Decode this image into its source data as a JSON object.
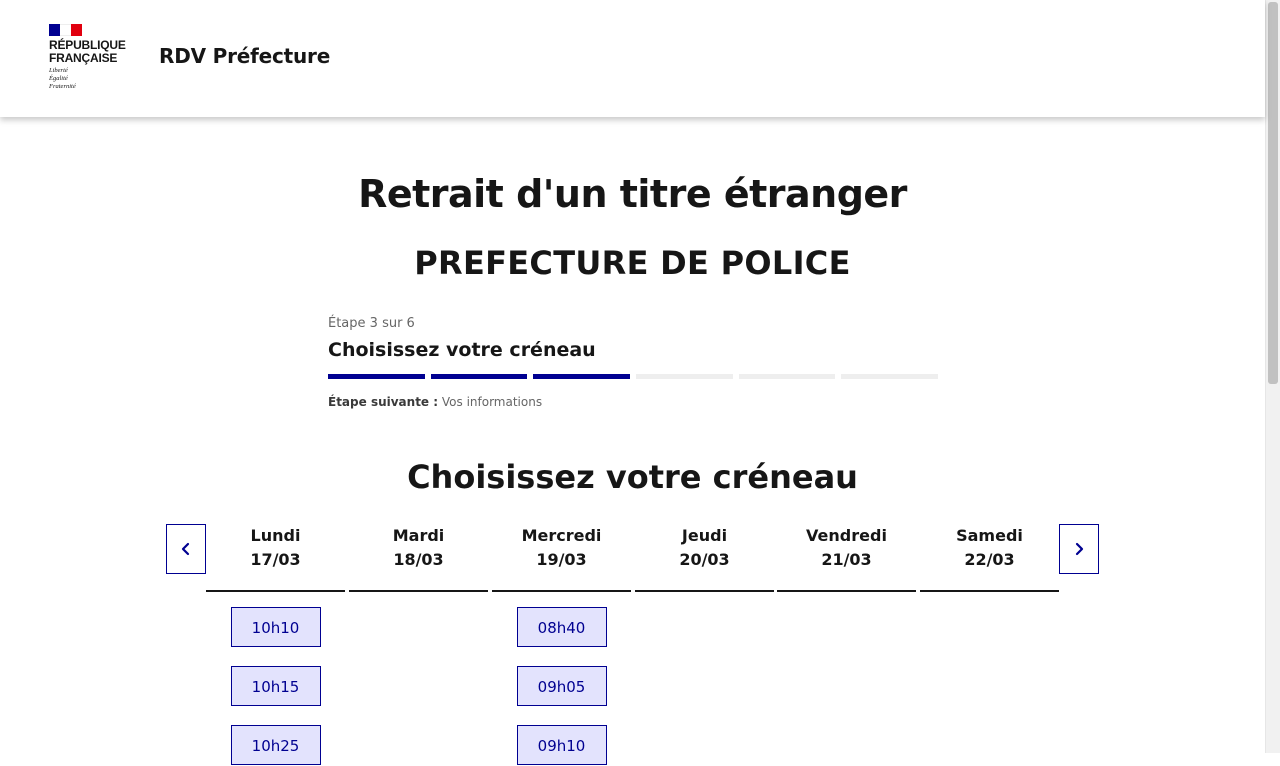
{
  "header": {
    "logo_title": "RÉPUBLIQUE\nFRANÇAISE",
    "logo_motto": "Liberté\nÉgalité\nFraternité",
    "service_name": "RDV Préfecture"
  },
  "main": {
    "title": "Retrait d'un titre étranger",
    "subtitle": "PREFECTURE DE POLICE",
    "stepper": {
      "state": "Étape 3 sur 6",
      "current_title": "Choisissez votre créneau",
      "total_steps": 6,
      "current_step": 3,
      "next_label": "Étape suivante :",
      "next_value": "Vos informations"
    },
    "section_title": "Choisissez votre créneau"
  },
  "calendar": {
    "prev_icon": "chevron-left-icon",
    "next_icon": "chevron-right-icon",
    "days": [
      {
        "name": "Lundi",
        "date": "17/03",
        "slots": [
          "10h10",
          "10h15",
          "10h25"
        ]
      },
      {
        "name": "Mardi",
        "date": "18/03",
        "slots": []
      },
      {
        "name": "Mercredi",
        "date": "19/03",
        "slots": [
          "08h40",
          "09h05",
          "09h10"
        ]
      },
      {
        "name": "Jeudi",
        "date": "20/03",
        "slots": []
      },
      {
        "name": "Vendredi",
        "date": "21/03",
        "slots": []
      },
      {
        "name": "Samedi",
        "date": "22/03",
        "slots": []
      }
    ]
  },
  "colors": {
    "primary_blue": "#000091",
    "slot_background": "#e3e3fd",
    "flag_red": "#e1000f",
    "text_dark": "#161616"
  }
}
